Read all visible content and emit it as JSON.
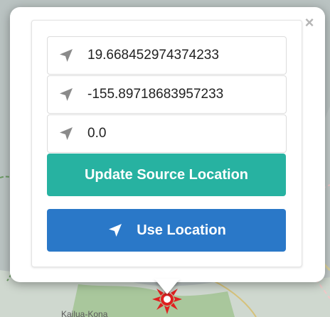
{
  "popup": {
    "close_label": "×",
    "latitude": {
      "value": "19.668452974374233",
      "icon": "location-arrow-icon"
    },
    "longitude": {
      "value": "-155.89718683957233",
      "icon": "location-arrow-icon"
    },
    "altitude": {
      "value": "0.0",
      "icon": "location-arrow-icon"
    },
    "update_button_label": "Update Source Location",
    "use_location_button_label": "Use Location",
    "use_location_icon": "location-arrow-icon"
  },
  "map": {
    "place_label": "Kailua-Kona",
    "marker_icon": "source-marker-icon"
  },
  "colors": {
    "update_button": "#27b2a1",
    "use_location_button": "#2a78c8",
    "marker": "#e02020"
  }
}
